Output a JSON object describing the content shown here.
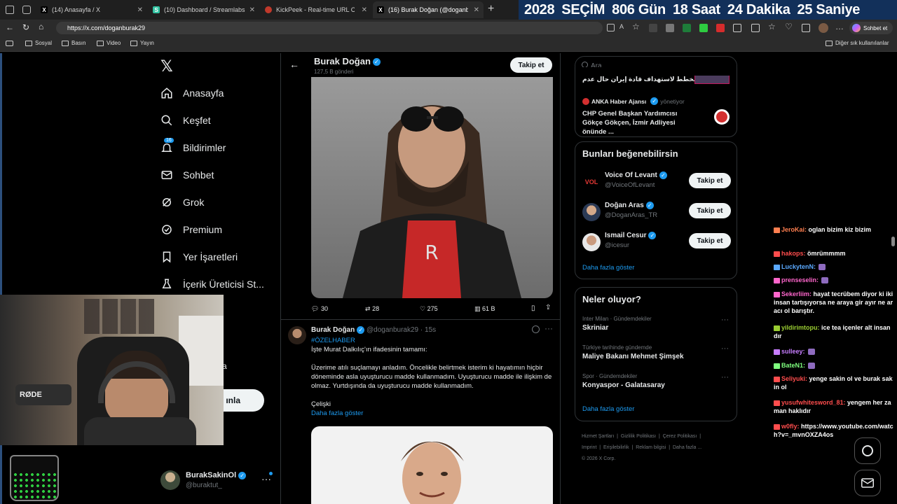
{
  "browser": {
    "tabs": [
      {
        "title": "(14) Anasayfa / X",
        "icon": "x-logo-icon"
      },
      {
        "title": "(10) Dashboard / Streamlabs",
        "icon": "streamlabs-icon"
      },
      {
        "title": "KickPeek - Real-time URL Crawler",
        "icon": "kickpeek-icon"
      },
      {
        "title": "(16) Burak Doğan (@doganburak29",
        "icon": "x-logo-icon"
      }
    ],
    "url": "https://x.com/doganburak29",
    "chat_button": "Sohbet et",
    "bookmarks": [
      "Sosyal",
      "Basın",
      "Video",
      "Yayın"
    ],
    "other_bookmarks": "Diğer sık kullanılanlar"
  },
  "countdown": {
    "year": "2028",
    "label": "SEÇİM",
    "days": "806 Gün",
    "hours": "18 Saat",
    "minutes": "24 Dakika",
    "seconds": "25 Saniye"
  },
  "nav": {
    "items": [
      {
        "label": "Anasayfa",
        "icon": "home-icon"
      },
      {
        "label": "Keşfet",
        "icon": "search-icon"
      },
      {
        "label": "Bildirimler",
        "icon": "bell-icon",
        "badge": "16"
      },
      {
        "label": "Sohbet",
        "icon": "mail-icon"
      },
      {
        "label": "Grok",
        "icon": "grok-icon"
      },
      {
        "label": "Premium",
        "icon": "premium-icon"
      },
      {
        "label": "Yer İşaretleri",
        "icon": "bookmark-icon"
      },
      {
        "label": "İçerik Üreticisi St...",
        "icon": "creator-icon"
      }
    ],
    "post_button_fragment": "ınla",
    "partial_label": "a",
    "account": {
      "name": "BurakSakinOl",
      "handle": "@buraktut_"
    }
  },
  "profile_header": {
    "name": "Burak Doğan",
    "posts": "127,5 B gönderi",
    "follow": "Takip et"
  },
  "post1": {
    "replies": "30",
    "reposts": "28",
    "likes": "275",
    "views": "61 B"
  },
  "post2": {
    "name": "Burak Doğan",
    "handle": "@doganburak29",
    "time": "15s",
    "hashtag": "#ÖZELHABER",
    "line1": "İşte Murat Dalkılıç'ın ifadesinin tamamı:",
    "body": "Üzerime atılı suçlamayı anladım. Öncelikle belirtmek isterim ki hayatımın hiçbir döneminde asla uyuşturucu madde kullanmadım. Uyuşturucu madde ile ilişkim de olmaz. Yurtdışında da uyuşturucu madde kullanmadım.",
    "line3": "Çelişki",
    "show_more": "Daha fazla göster"
  },
  "search": {
    "placeholder": "Ara"
  },
  "news_top": {
    "headline_fragment": "مخطط لاستهداف قادة إيران حال عدم",
    "source": "ANKA Haber Ajansı",
    "source_role": "yönetiyor",
    "headline": "CHP Genel Başkan Yardımcısı Gökçe Gökçen, İzmir Adliyesi önünde ..."
  },
  "suggestions": {
    "title": "Bunları beğenebilirsin",
    "items": [
      {
        "name": "Voice Of Levant",
        "handle": "@VoiceOfLevant",
        "avatar_text": "VOL"
      },
      {
        "name": "Doğan Aras",
        "handle": "@DoganAras_TR",
        "avatar_text": ""
      },
      {
        "name": "Ismail Cesur",
        "handle": "@icesur",
        "avatar_text": ""
      }
    ],
    "follow": "Takip et",
    "show_more": "Daha fazla göster"
  },
  "trends": {
    "title": "Neler oluyor?",
    "items": [
      {
        "context": "Inter Milan · Gündemdekiler",
        "name": "Skriniar"
      },
      {
        "context": "Türkiye tarihinde gündemde",
        "name": "Maliye Bakanı Mehmet Şimşek"
      },
      {
        "context": "Spor · Gündemdekiler",
        "name": "Konyaspor - Galatasaray"
      }
    ],
    "show_more": "Daha fazla göster"
  },
  "footer": {
    "links": [
      "Hizmet Şartları",
      "Gizlilik Politikası",
      "Çerez Politikası",
      "Imprint",
      "Erişilebilirlik",
      "Reklam bilgisi",
      "Daha fazla ..."
    ],
    "copyright": "© 2026 X Corp."
  },
  "chat": [
    {
      "user": "JeroKai:",
      "msg": "oglan bizim kiz bizim",
      "color": "#ff7f50"
    },
    {
      "user": "hakops:",
      "msg": "ömrümmmm",
      "color": "#ff4d4d"
    },
    {
      "user": "LuckytenN:",
      "msg": "",
      "color": "#5aa9ff"
    },
    {
      "user": "prenseselin:",
      "msg": "",
      "color": "#ff66cc"
    },
    {
      "user": "Sekerliim:",
      "msg": "hayat tecrübem diyor ki iki insan tartışıyorsa ne araya gir ayır ne aracı ol barıştır.",
      "color": "#ff66cc"
    },
    {
      "user": "yildirimtopu:",
      "msg": "ice tea içenler alt insandır",
      "color": "#9acd32"
    },
    {
      "user": "sulleey:",
      "msg": "",
      "color": "#c77dff"
    },
    {
      "user": "BateN1:",
      "msg": "",
      "color": "#7fff7f"
    },
    {
      "user": "Seliyuki:",
      "msg": "yenge sakin ol ve burak sakin ol",
      "color": "#ff4d4d"
    },
    {
      "user": "yusufwhitesword_81:",
      "msg": "yengem her zaman haklıdır",
      "color": "#ff4d4d"
    },
    {
      "user": "w0fly:",
      "msg": "https://www.youtube.com/watch?v=_mvnOXZA4os",
      "color": "#ff4d4d"
    }
  ]
}
